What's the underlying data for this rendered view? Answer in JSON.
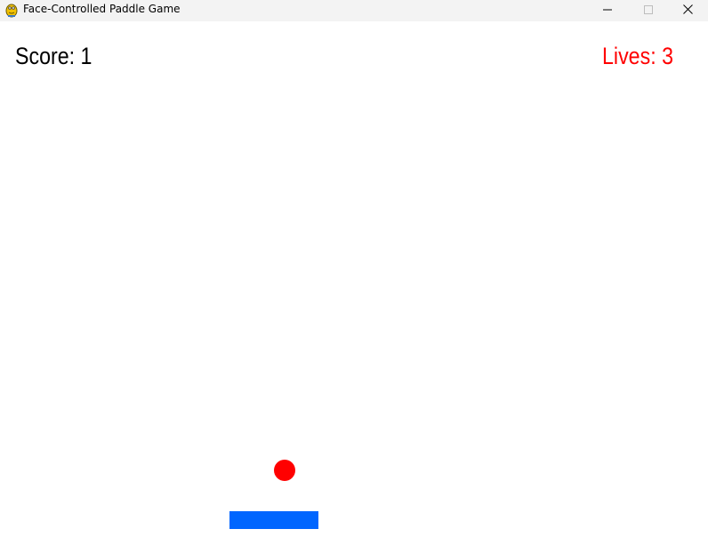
{
  "window": {
    "title": "Face-Controlled Paddle Game",
    "icons": {
      "app": "pygame-snake-icon",
      "minimize": "minimize-icon",
      "maximize": "maximize-icon",
      "close": "close-icon"
    }
  },
  "hud": {
    "score_text": "Score: 1",
    "lives_text": "Lives: 3"
  },
  "colors": {
    "background": "#ffffff",
    "titlebar": "#f3f3f3",
    "score_text": "#000000",
    "lives_text": "#ff0000",
    "ball": "#ff0000",
    "paddle": "#0066ff"
  }
}
